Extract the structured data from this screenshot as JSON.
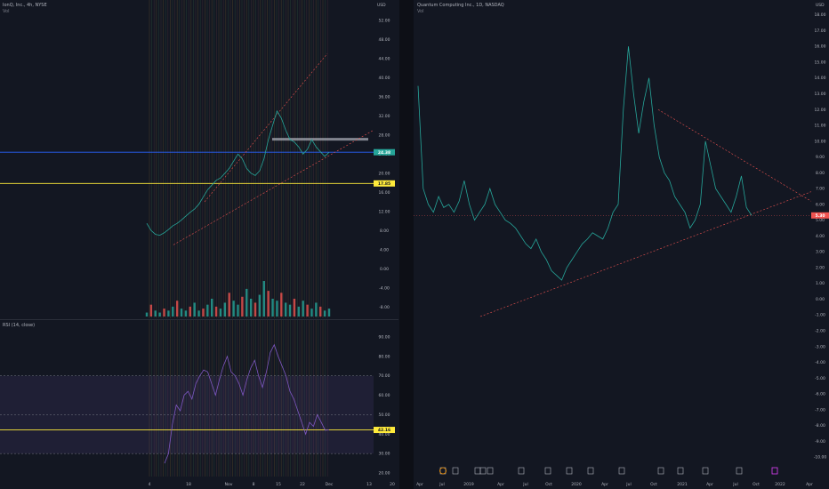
{
  "left": {
    "title": "IonQ, Inc., 4h, NYSE",
    "sub": "Vol",
    "currency": "USD",
    "price_axis": [
      "52.00",
      "48.00",
      "44.00",
      "40.00",
      "36.00",
      "32.00",
      "28.00",
      "24.00",
      "20.00",
      "16.00",
      "12.00",
      "8.00",
      "4.00",
      "0.00",
      "-4.00",
      "-8.00"
    ],
    "tag_current": "24.38",
    "tag_support": "17.85",
    "rsi_title": "RSI (14, close)",
    "rsi_axis": [
      "90.00",
      "80.00",
      "70.00",
      "60.00",
      "50.00",
      "40.00",
      "30.00",
      "20.00"
    ],
    "rsi_tag": "42.16",
    "time_axis": [
      "4",
      "18",
      "Nov",
      "8",
      "15",
      "22",
      "Dec",
      "13",
      "20"
    ]
  },
  "right": {
    "title": "Quantum Computing Inc., 1D, NASDAQ",
    "sub": "Vol",
    "currency": "USD",
    "price_axis": [
      "18.00",
      "17.00",
      "16.00",
      "15.00",
      "14.00",
      "13.00",
      "12.00",
      "11.00",
      "10.00",
      "9.00",
      "8.00",
      "7.00",
      "6.00",
      "5.00",
      "4.00",
      "3.00",
      "2.00",
      "1.00",
      "0.00",
      "-1.00",
      "-2.00",
      "-3.00",
      "-4.00",
      "-5.00",
      "-6.00",
      "-7.00",
      "-8.00",
      "-9.00",
      "-10.00"
    ],
    "tag_current": "5.30",
    "time_axis": [
      "Apr",
      "Jul",
      "2019",
      "Apr",
      "Jul",
      "Oct",
      "2020",
      "Apr",
      "Jul",
      "Oct",
      "2021",
      "Apr",
      "Jul",
      "Oct",
      "2022",
      "Apr"
    ]
  },
  "chart_data": [
    {
      "type": "line",
      "panel": "left-price",
      "x_labels": [
        "4",
        "18",
        "Nov",
        "8",
        "15",
        "22",
        "Dec",
        "13",
        "20"
      ],
      "ylim": [
        -10,
        54
      ],
      "series": [
        {
          "values": [
            9.5,
            8.0,
            7.2,
            7.0,
            7.5,
            8.2,
            9.0,
            9.5,
            10.2,
            11.0,
            11.8,
            12.5,
            13.5,
            15.0,
            16.5,
            17.5,
            18.5,
            19.0,
            20.0,
            21.0,
            22.5,
            24.0,
            23.0,
            21.0,
            20.0,
            19.5,
            20.5,
            23.0,
            27.0,
            30.0,
            33.0,
            31.5,
            29.0,
            27.0,
            26.5,
            25.5,
            24.0,
            25.0,
            27.0,
            25.5,
            24.5,
            23.5,
            24.38
          ]
        }
      ],
      "horizontal_levels": [
        24.38,
        17.85
      ],
      "resistance_zone": 27.0
    },
    {
      "type": "bar",
      "panel": "left-volume",
      "values": [
        2,
        6,
        3,
        2,
        4,
        3,
        5,
        8,
        4,
        3,
        5,
        7,
        3,
        4,
        6,
        9,
        5,
        4,
        7,
        12,
        8,
        6,
        10,
        14,
        9,
        7,
        11,
        18,
        13,
        9,
        8,
        12,
        7,
        6,
        9,
        5,
        8,
        6,
        4,
        7,
        5,
        3,
        4
      ]
    },
    {
      "type": "line",
      "panel": "left-rsi",
      "ylim": [
        20,
        95
      ],
      "series": [
        {
          "values": [
            25,
            30,
            45,
            55,
            52,
            60,
            62,
            58,
            66,
            70,
            73,
            72,
            66,
            60,
            68,
            75,
            80,
            72,
            70,
            66,
            60,
            68,
            74,
            78,
            70,
            64,
            72,
            82,
            86,
            80,
            75,
            70,
            62,
            58,
            52,
            46,
            40,
            46,
            44,
            50,
            46,
            42,
            42.16
          ]
        }
      ],
      "levels": [
        70,
        50,
        30
      ],
      "marker_level": 42.16
    },
    {
      "type": "line",
      "panel": "right-price",
      "x_labels": [
        "Apr",
        "Jul",
        "2019",
        "Apr",
        "Jul",
        "Oct",
        "2020",
        "Apr",
        "Jul",
        "Oct",
        "2021",
        "Apr",
        "Jul",
        "Oct",
        "2022",
        "Apr"
      ],
      "ylim": [
        -10.5,
        18.6
      ],
      "series": [
        {
          "values": [
            13.5,
            7.0,
            6.0,
            5.5,
            6.5,
            5.8,
            6.0,
            5.5,
            6.2,
            7.5,
            6.0,
            5.0,
            5.5,
            6.0,
            7.0,
            6.0,
            5.5,
            5.0,
            4.8,
            4.5,
            4.0,
            3.5,
            3.2,
            3.8,
            3.0,
            2.5,
            1.8,
            1.5,
            1.2,
            2.0,
            2.5,
            3.0,
            3.5,
            3.8,
            4.2,
            4.0,
            3.8,
            4.5,
            5.5,
            6.0,
            12.0,
            16.0,
            13.0,
            10.5,
            12.5,
            14.0,
            11.0,
            9.0,
            8.0,
            7.5,
            6.5,
            6.0,
            5.5,
            4.5,
            5.0,
            6.0,
            10.0,
            8.5,
            7.0,
            6.5,
            6.0,
            5.5,
            6.5,
            7.8,
            5.8,
            5.3
          ]
        }
      ],
      "trendlines": "symmetrical triangle",
      "horizontal_level": 5.3
    }
  ]
}
